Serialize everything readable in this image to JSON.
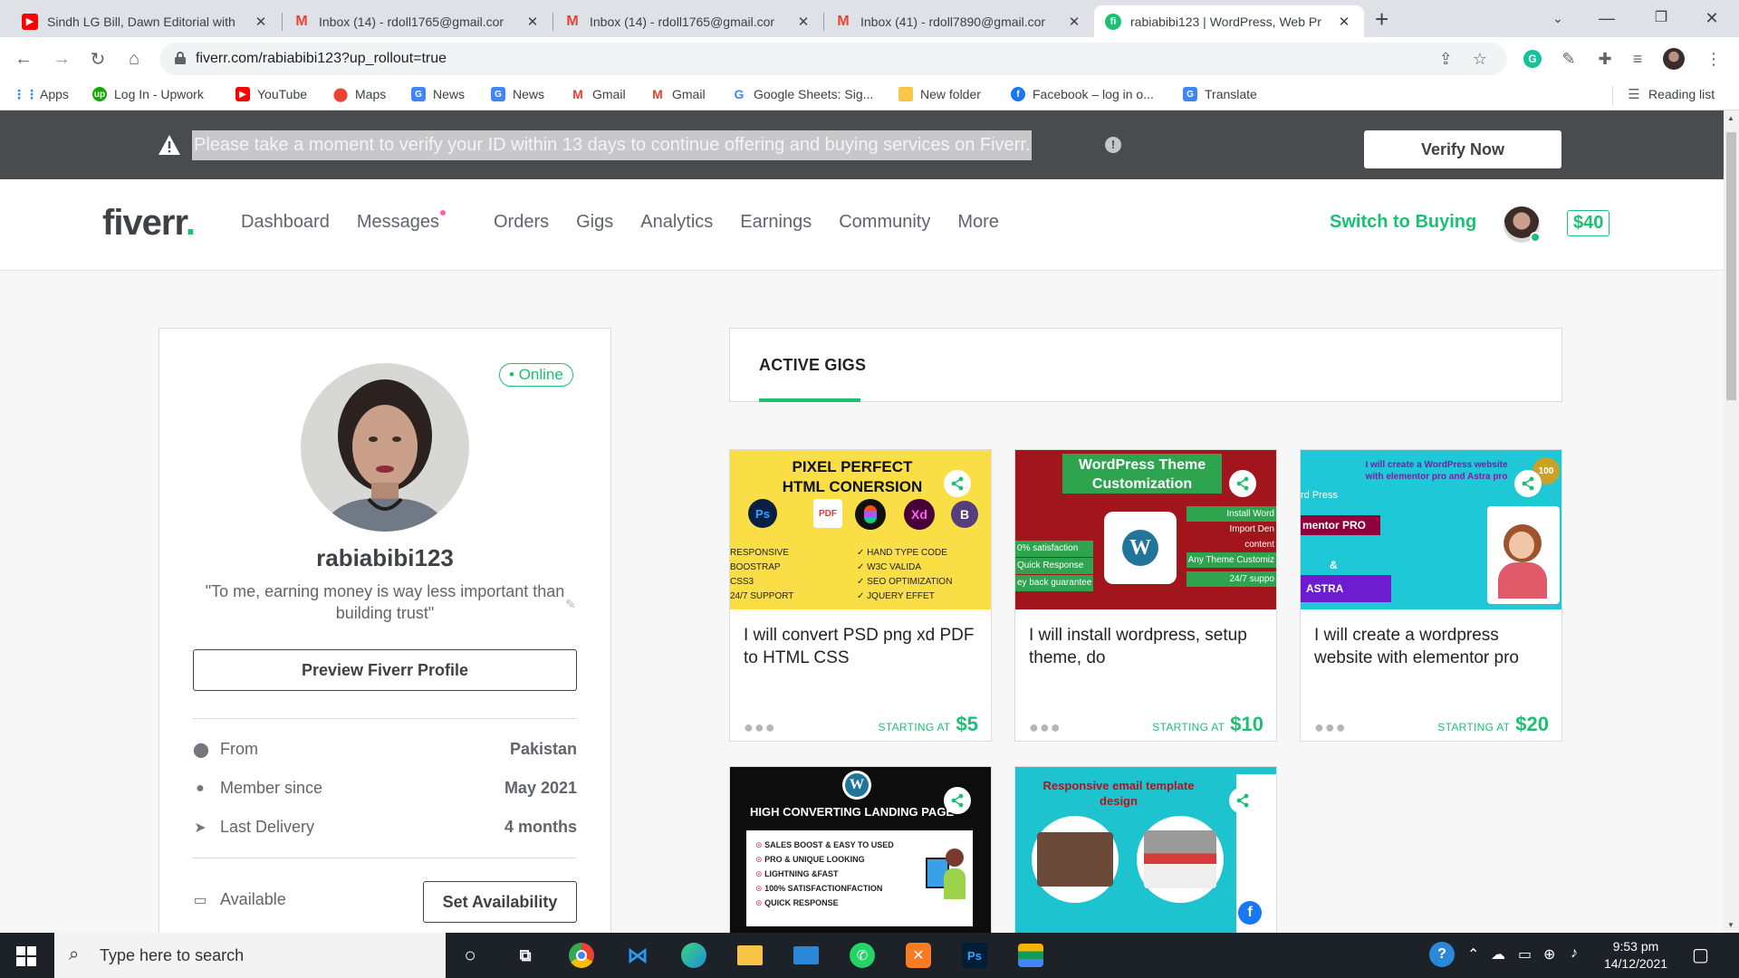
{
  "browser": {
    "tabs": [
      {
        "title": "Sindh LG Bill, Dawn Editorial with",
        "favicon": "youtube-icon",
        "color": "#ff0000"
      },
      {
        "title": "Inbox (14) - rdoll1765@gmail.cor",
        "favicon": "gmail-icon",
        "color": "#ea4335"
      },
      {
        "title": "Inbox (14) - rdoll1765@gmail.cor",
        "favicon": "gmail-icon",
        "color": "#ea4335"
      },
      {
        "title": "Inbox (41) - rdoll7890@gmail.cor",
        "favicon": "gmail-icon",
        "color": "#ea4335"
      },
      {
        "title": "rabiabibi123 | WordPress, Web Pr",
        "favicon": "fiverr-icon",
        "color": "#1dbf73"
      }
    ],
    "url": "fiverr.com/rabiabibi123?up_rollout=true",
    "bookmarks": [
      {
        "label": "Apps",
        "icon": "apps-grid-icon"
      },
      {
        "label": "Log In - Upwork",
        "icon": "upwork-icon"
      },
      {
        "label": "YouTube",
        "icon": "youtube-icon"
      },
      {
        "label": "Maps",
        "icon": "maps-icon"
      },
      {
        "label": "News",
        "icon": "google-news-icon"
      },
      {
        "label": "News",
        "icon": "google-news-icon"
      },
      {
        "label": "Gmail",
        "icon": "gmail-icon"
      },
      {
        "label": "Gmail",
        "icon": "gmail-icon"
      },
      {
        "label": "Google Sheets: Sig...",
        "icon": "google-icon"
      },
      {
        "label": "New folder",
        "icon": "folder-icon"
      },
      {
        "label": "Facebook – log in o...",
        "icon": "facebook-icon"
      },
      {
        "label": "Translate",
        "icon": "translate-icon"
      }
    ],
    "reading_list": "Reading list"
  },
  "banner": {
    "message": "Please take a moment to verify your ID within 13 days to continue offering and buying services on Fiverr.",
    "button": "Verify Now"
  },
  "header": {
    "logo": "fiverr",
    "nav": [
      "Dashboard",
      "Messages",
      "Orders",
      "Gigs",
      "Analytics",
      "Earnings",
      "Community",
      "More"
    ],
    "switch": "Switch to Buying",
    "balance": "$40"
  },
  "profile": {
    "status": "Online",
    "username": "rabiabibi123",
    "quote": "\"To me, earning money is way less important than building trust\"",
    "preview_button": "Preview Fiverr Profile",
    "stats": [
      {
        "label": "From",
        "value": "Pakistan",
        "icon": "location-pin-icon"
      },
      {
        "label": "Member since",
        "value": "May 2021",
        "icon": "user-icon"
      },
      {
        "label": "Last Delivery",
        "value": "4 months",
        "icon": "paper-plane-icon"
      }
    ],
    "availability_label": "Available",
    "availability_button": "Set Availability"
  },
  "gigs": {
    "heading": "ACTIVE GIGS",
    "starting_at": "STARTING AT",
    "items": [
      {
        "title": "I will convert PSD png xd PDF to HTML CSS",
        "price": "$5",
        "thumb_lines": [
          "PIXEL PERFECT",
          "HTML CONERSION"
        ],
        "thumb_list_left": [
          "RESPONSIVE",
          "BOOSTRAP",
          "CSS3",
          "24/7 SUPPORT"
        ],
        "thumb_list_right": [
          "HAND TYPE CODE",
          "W3C VALIDA",
          "SEO OPTIMIZATION",
          "JQUERY EFFET"
        ]
      },
      {
        "title": "I will install wordpress, setup theme, do",
        "price": "$10",
        "thumb_lines": [
          "WordPress Theme",
          "Customization"
        ],
        "thumb_list_left": [
          "0% satisfaction",
          "Quick Response",
          "ey back guarantee"
        ],
        "thumb_list_right": [
          "Install Word",
          "Import Den",
          "content",
          "Any Theme Customiz",
          "24/7 suppo"
        ]
      },
      {
        "title": "I will create a wordpress website with elementor pro",
        "price": "$20",
        "thumb_lines": [
          "I will create a WordPress website",
          "with elementor pro and Astra pro"
        ],
        "thumb_badges": [
          "rd Press",
          "mentor PRO",
          "&",
          "ASTRA"
        ]
      },
      {
        "title": "",
        "price": "",
        "thumb_lines": [
          "HIGH CONVERTING LANDING PAGE"
        ],
        "thumb_list_left": [
          "SALES BOOST & EASY TO USED",
          "PRO & UNIQUE LOOKING",
          "LIGHTNING &FAST",
          "100% SATISFACTIONFACTION",
          "QUICK RESPONSE"
        ]
      },
      {
        "title": "",
        "price": "",
        "thumb_lines": [
          "Responsive email template",
          "design"
        ]
      }
    ]
  },
  "taskbar": {
    "search_placeholder": "Type here to search",
    "time": "9:53 pm",
    "date": "14/12/2021"
  },
  "colors": {
    "brand": "#1dbf73",
    "banner": "#4a4b4e",
    "text": "#404145"
  }
}
